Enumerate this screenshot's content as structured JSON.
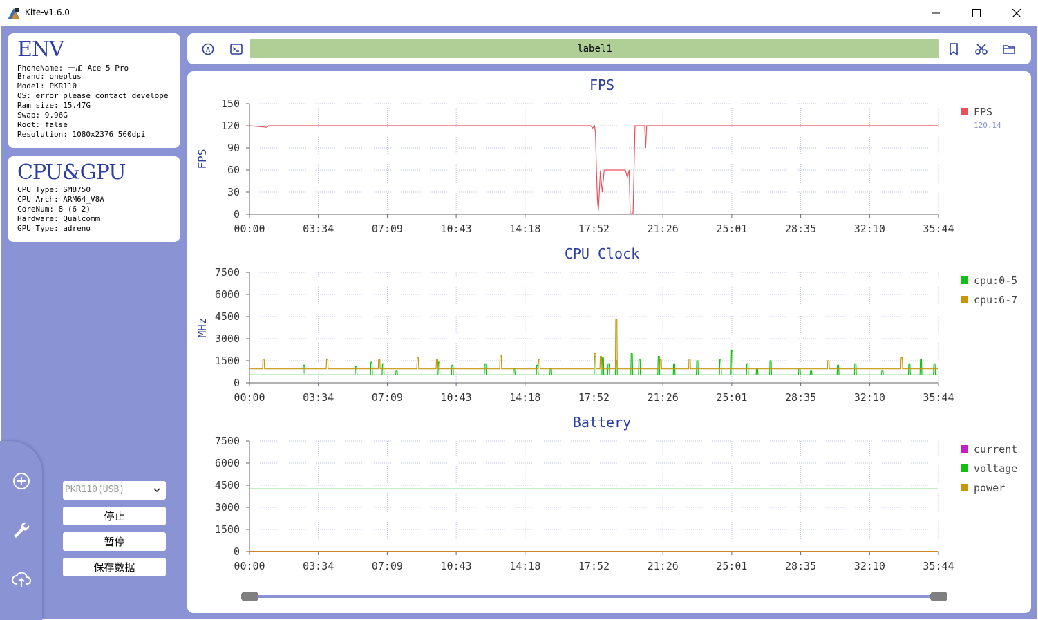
{
  "window": {
    "title": "Kite-v1.6.0"
  },
  "env": {
    "title": "ENV",
    "lines": [
      "PhoneName: 一加 Ace 5 Pro",
      "Brand: oneplus",
      "Model: PKR110",
      "OS: error please contact develope",
      "Ram size: 15.47G",
      "Swap: 9.96G",
      "Root: false",
      "Resolution: 1080x2376 560dpi"
    ]
  },
  "cpugpu": {
    "title": "CPU&GPU",
    "lines": [
      "CPU Type: SM8750",
      "CPU Arch: ARM64_V8A",
      "CoreNum: 8 (6+2)",
      "Hardware: Qualcomm",
      "GPU Type: adreno"
    ]
  },
  "controls": {
    "device_select": "PKR110(USB)",
    "stop": "停止",
    "pause": "暂停",
    "save": "保存数据"
  },
  "toolbar": {
    "label": "label1"
  },
  "colors": {
    "accent": "#8a93d4",
    "title_blue": "#2c3fa0",
    "label_bar": "#afcf97",
    "fps": "#e8505b",
    "cpu_small": "#11c011",
    "cpu_big": "#c8960c",
    "current": "#c81ec8",
    "voltage": "#11c011",
    "power": "#c8960c"
  },
  "icons": {
    "sidebar": [
      "add-circle-icon",
      "wrench-icon",
      "cloud-upload-icon"
    ],
    "toolbar": [
      "auto-icon",
      "terminal-icon",
      "bookmark-icon",
      "scissors-icon",
      "folder-icon"
    ]
  },
  "chart_data": [
    {
      "type": "line",
      "title": "FPS",
      "ylabel": "FPS",
      "xlabel": "",
      "ylim": [
        0,
        150
      ],
      "yticks": [
        0,
        30,
        60,
        90,
        120,
        150
      ],
      "xticks": [
        "00:00",
        "03:34",
        "07:09",
        "10:43",
        "14:18",
        "17:52",
        "21:26",
        "25:01",
        "28:35",
        "32:10",
        "35:44"
      ],
      "grid": true,
      "legend": "right",
      "series": [
        {
          "name": "FPS",
          "current_value": "120.14",
          "points": [
            [
              0,
              120
            ],
            [
              0.9,
              118
            ],
            [
              1.0,
              120
            ],
            [
              17.7,
              120
            ],
            [
              17.8,
              117
            ],
            [
              17.9,
              120
            ],
            [
              17.95,
              110
            ],
            [
              18.0,
              60
            ],
            [
              18.05,
              20
            ],
            [
              18.1,
              5
            ],
            [
              18.2,
              58
            ],
            [
              18.3,
              30
            ],
            [
              18.4,
              60
            ],
            [
              19.5,
              60
            ],
            [
              19.6,
              50
            ],
            [
              19.7,
              60
            ],
            [
              19.75,
              0
            ],
            [
              19.9,
              2
            ],
            [
              20.0,
              120
            ],
            [
              20.5,
              120
            ],
            [
              20.55,
              90
            ],
            [
              20.6,
              120
            ],
            [
              35.74,
              120
            ]
          ]
        }
      ]
    },
    {
      "type": "line",
      "title": "CPU Clock",
      "ylabel": "MHz",
      "xlabel": "",
      "ylim": [
        0,
        7500
      ],
      "yticks": [
        0,
        1500,
        3000,
        4500,
        6000,
        7500
      ],
      "xticks": [
        "00:00",
        "03:34",
        "07:09",
        "10:43",
        "14:18",
        "17:52",
        "21:26",
        "25:01",
        "28:35",
        "32:10",
        "35:44"
      ],
      "grid": true,
      "legend": "right",
      "series": [
        {
          "name": "cpu:0-5",
          "baseline": 550,
          "spikes": [
            [
              2.8,
              1200
            ],
            [
              5.5,
              1100
            ],
            [
              6.3,
              1400
            ],
            [
              6.9,
              1300
            ],
            [
              7.6,
              800
            ],
            [
              9.8,
              1400
            ],
            [
              10.5,
              1200
            ],
            [
              12.2,
              1300
            ],
            [
              13.7,
              1000
            ],
            [
              14.9,
              1200
            ],
            [
              15.6,
              1000
            ],
            [
              17.9,
              1800
            ],
            [
              18.3,
              1700
            ],
            [
              18.6,
              1300
            ],
            [
              19.0,
              1500
            ],
            [
              19.8,
              2000
            ],
            [
              20.2,
              1600
            ],
            [
              21.2,
              1800
            ],
            [
              22.0,
              1300
            ],
            [
              23.2,
              1500
            ],
            [
              24.4,
              1600
            ],
            [
              25.0,
              2200
            ],
            [
              25.8,
              1300
            ],
            [
              26.3,
              1000
            ],
            [
              27.0,
              1500
            ],
            [
              28.5,
              1000
            ],
            [
              29.1,
              800
            ],
            [
              30.5,
              1200
            ],
            [
              31.4,
              1300
            ],
            [
              32.8,
              800
            ],
            [
              34.2,
              1300
            ],
            [
              34.8,
              1600
            ],
            [
              35.5,
              1300
            ]
          ]
        },
        {
          "name": "cpu:6-7",
          "baseline": 950,
          "spikes": [
            [
              0.7,
              1600
            ],
            [
              4.0,
              1600
            ],
            [
              6.7,
              1600
            ],
            [
              8.7,
              1700
            ],
            [
              9.7,
              1600
            ],
            [
              13.0,
              1900
            ],
            [
              15.0,
              1600
            ],
            [
              17.9,
              2000
            ],
            [
              18.2,
              1800
            ],
            [
              19.0,
              4300
            ],
            [
              21.3,
              1600
            ],
            [
              22.8,
              1600
            ],
            [
              30.0,
              1500
            ],
            [
              33.8,
              1700
            ]
          ]
        }
      ]
    },
    {
      "type": "line",
      "title": "Battery",
      "ylabel": "",
      "xlabel": "",
      "ylim": [
        0,
        7500
      ],
      "yticks": [
        0,
        1500,
        3000,
        4500,
        6000,
        7500
      ],
      "xticks": [
        "00:00",
        "03:34",
        "07:09",
        "10:43",
        "14:18",
        "17:52",
        "21:26",
        "25:01",
        "28:35",
        "32:10",
        "35:44"
      ],
      "grid": true,
      "legend": "right",
      "series": [
        {
          "name": "current",
          "values_note": "",
          "level": 20
        },
        {
          "name": "voltage",
          "level": 4250
        },
        {
          "name": "power",
          "level": 10
        }
      ]
    }
  ],
  "slider": {
    "start": 0,
    "end": 1
  }
}
